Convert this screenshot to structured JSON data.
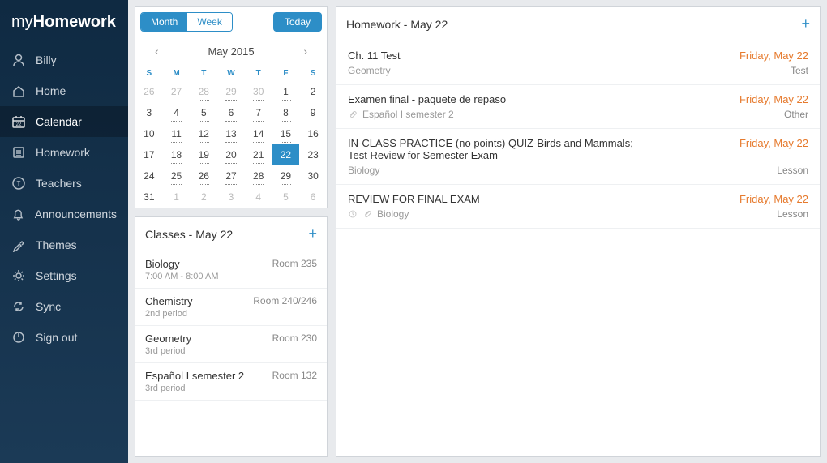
{
  "logo": {
    "pre": "my",
    "strong": "Homework"
  },
  "nav": [
    {
      "key": "user",
      "label": "Billy",
      "icon": "user"
    },
    {
      "key": "home",
      "label": "Home",
      "icon": "home"
    },
    {
      "key": "calendar",
      "label": "Calendar",
      "icon": "calendar",
      "active": true
    },
    {
      "key": "homework",
      "label": "Homework",
      "icon": "list"
    },
    {
      "key": "teachers",
      "label": "Teachers",
      "icon": "teacher"
    },
    {
      "key": "announcements",
      "label": "Announcements",
      "icon": "bell"
    },
    {
      "key": "themes",
      "label": "Themes",
      "icon": "brush"
    },
    {
      "key": "settings",
      "label": "Settings",
      "icon": "gear"
    },
    {
      "key": "sync",
      "label": "Sync",
      "icon": "sync"
    },
    {
      "key": "signout",
      "label": "Sign out",
      "icon": "power"
    }
  ],
  "calendar": {
    "month_label": "Month",
    "week_label": "Week",
    "today_label": "Today",
    "title": "May 2015",
    "dow": [
      "S",
      "M",
      "T",
      "W",
      "T",
      "F",
      "S"
    ],
    "days": [
      {
        "n": "26",
        "other": true
      },
      {
        "n": "27",
        "other": true
      },
      {
        "n": "28",
        "other": true,
        "d": true
      },
      {
        "n": "29",
        "other": true,
        "d": true
      },
      {
        "n": "30",
        "other": true,
        "d": true
      },
      {
        "n": "1",
        "d": true
      },
      {
        "n": "2"
      },
      {
        "n": "3"
      },
      {
        "n": "4",
        "d": true
      },
      {
        "n": "5",
        "d": true
      },
      {
        "n": "6",
        "d": true
      },
      {
        "n": "7",
        "d": true
      },
      {
        "n": "8",
        "d": true
      },
      {
        "n": "9"
      },
      {
        "n": "10"
      },
      {
        "n": "11",
        "d": true
      },
      {
        "n": "12",
        "d": true
      },
      {
        "n": "13",
        "d": true
      },
      {
        "n": "14",
        "d": true
      },
      {
        "n": "15",
        "d": true
      },
      {
        "n": "16"
      },
      {
        "n": "17"
      },
      {
        "n": "18",
        "d": true
      },
      {
        "n": "19",
        "d": true
      },
      {
        "n": "20",
        "d": true
      },
      {
        "n": "21",
        "d": true
      },
      {
        "n": "22",
        "selected": true
      },
      {
        "n": "23"
      },
      {
        "n": "24"
      },
      {
        "n": "25",
        "d": true
      },
      {
        "n": "26",
        "d": true
      },
      {
        "n": "27",
        "d": true
      },
      {
        "n": "28",
        "d": true
      },
      {
        "n": "29",
        "d": true
      },
      {
        "n": "30"
      },
      {
        "n": "31"
      },
      {
        "n": "1",
        "other": true
      },
      {
        "n": "2",
        "other": true
      },
      {
        "n": "3",
        "other": true
      },
      {
        "n": "4",
        "other": true
      },
      {
        "n": "5",
        "other": true
      },
      {
        "n": "6",
        "other": true
      }
    ]
  },
  "classes": {
    "title": "Classes - May 22",
    "items": [
      {
        "name": "Biology",
        "sub": "7:00 AM - 8:00 AM",
        "room": "Room 235"
      },
      {
        "name": "Chemistry",
        "sub": "2nd period",
        "room": "Room 240/246"
      },
      {
        "name": "Geometry",
        "sub": "3rd period",
        "room": "Room 230"
      },
      {
        "name": "Español I semester 2",
        "sub": "3rd period",
        "room": "Room 132"
      }
    ]
  },
  "homework": {
    "title": "Homework - May 22",
    "items": [
      {
        "title": "Ch. 11 Test",
        "subject": "Geometry",
        "due": "Friday, May 22",
        "type": "Test"
      },
      {
        "title": "Examen final - paquete de repaso",
        "subject": "Español I semester 2",
        "due": "Friday, May 22",
        "type": "Other",
        "attach": true
      },
      {
        "title": "IN-CLASS PRACTICE (no points) QUIZ-Birds and Mammals;\nTest Review for Semester Exam",
        "subject": "Biology",
        "due": "Friday, May 22",
        "type": "Lesson"
      },
      {
        "title": "REVIEW FOR FINAL EXAM",
        "subject": "Biology",
        "due": "Friday, May 22",
        "type": "Lesson",
        "clock": true,
        "attach": true
      }
    ]
  }
}
